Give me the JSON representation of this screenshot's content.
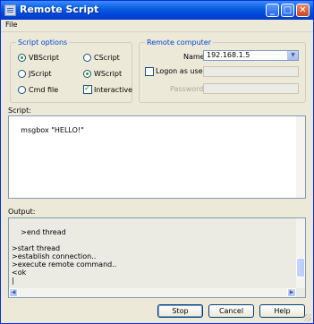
{
  "window": {
    "title": "Remote Script"
  },
  "menu": {
    "file": "File"
  },
  "script_options": {
    "label": "Script options",
    "vbscript": "VBScript",
    "cscript": "CScript",
    "jscript": "JScript",
    "wscript": "WScript",
    "cmd_file": "Cmd file",
    "interactive": "Interactive",
    "selected_language": "VBScript",
    "selected_host": "WScript",
    "interactive_checked": true
  },
  "remote_computer": {
    "label": "Remote computer",
    "name_label": "Name",
    "name_value": "192.168.1.5",
    "logon_as_user": "Logon as user",
    "logon_checked": false,
    "password_label": "Password",
    "user_value": "",
    "password_value": ""
  },
  "script": {
    "label": "Script:",
    "content": "msgbox \"HELLO!\""
  },
  "output": {
    "label": "Output:",
    "content": ">end thread\n\n>start thread\n>establish connection..\n>execute remote command..\n<ok\n|"
  },
  "buttons": {
    "stop": "Stop",
    "cancel": "Cancel",
    "help": "Help"
  },
  "icons": {
    "app": "script-window-icon",
    "minimize": "minimize-icon",
    "maximize": "maximize-icon",
    "close": "close-icon"
  },
  "colors": {
    "titlebar": "#0a5fe0",
    "group_label": "#0046d5"
  }
}
